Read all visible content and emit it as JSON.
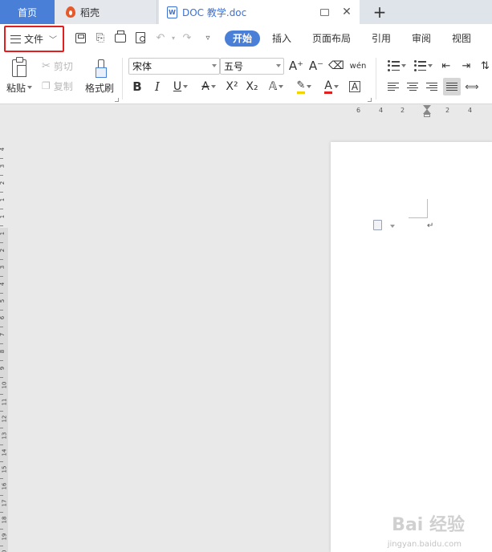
{
  "tabs": {
    "home": "首页",
    "daoke": "稻壳",
    "doc": "DOC 教学.doc"
  },
  "menu": {
    "file": "文件",
    "ribbon_tabs": [
      "开始",
      "插入",
      "页面布局",
      "引用",
      "审阅",
      "视图"
    ]
  },
  "ribbon": {
    "paste": "粘贴",
    "cut": "剪切",
    "copy": "复制",
    "format_painter": "格式刷",
    "font_name": "宋体",
    "font_size": "五号"
  },
  "ruler": {
    "h_ticks": [
      "6",
      "4",
      "2",
      "2",
      "4"
    ],
    "v_ticks": [
      "4",
      "3",
      "2",
      "1",
      "1",
      "1",
      "2",
      "3",
      "4",
      "5",
      "6",
      "7",
      "8",
      "9",
      "10",
      "11",
      "12",
      "13",
      "14",
      "15",
      "16",
      "17",
      "18",
      "19",
      "20"
    ]
  },
  "watermark": {
    "brand": "Bai 经验",
    "url": "jingyan.baidu.com"
  },
  "colors": {
    "accent": "#4a7fd8",
    "highlight_border": "#e02020"
  }
}
